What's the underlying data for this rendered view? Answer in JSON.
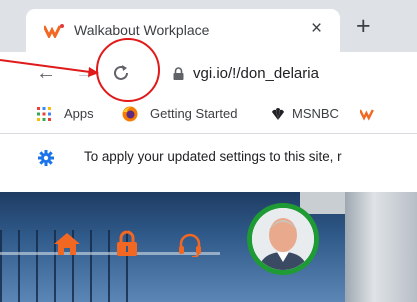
{
  "browser": {
    "tab": {
      "title": "Walkabout Workplace",
      "close_label": "×",
      "favicon": "walkabout-logo"
    },
    "new_tab_label": "+",
    "nav": {
      "back_label": "←",
      "forward_label": "→"
    },
    "url": "vgi.io/!/don_delaria"
  },
  "bookmarks": [
    {
      "label": "Apps",
      "icon": "apps-grid-icon"
    },
    {
      "label": "Getting Started",
      "icon": "firefox-icon"
    },
    {
      "label": "MSNBC",
      "icon": "nbc-peacock-icon"
    }
  ],
  "infobar": {
    "text": "To apply your updated settings to this site, r",
    "icon": "gear-icon"
  },
  "page": {
    "icons": [
      "home-icon",
      "lock-icon",
      "headset-icon"
    ],
    "accent": "#f26722",
    "avatar_ring": "#1e9b34"
  },
  "annotation": {
    "color": "#e01a1a"
  }
}
